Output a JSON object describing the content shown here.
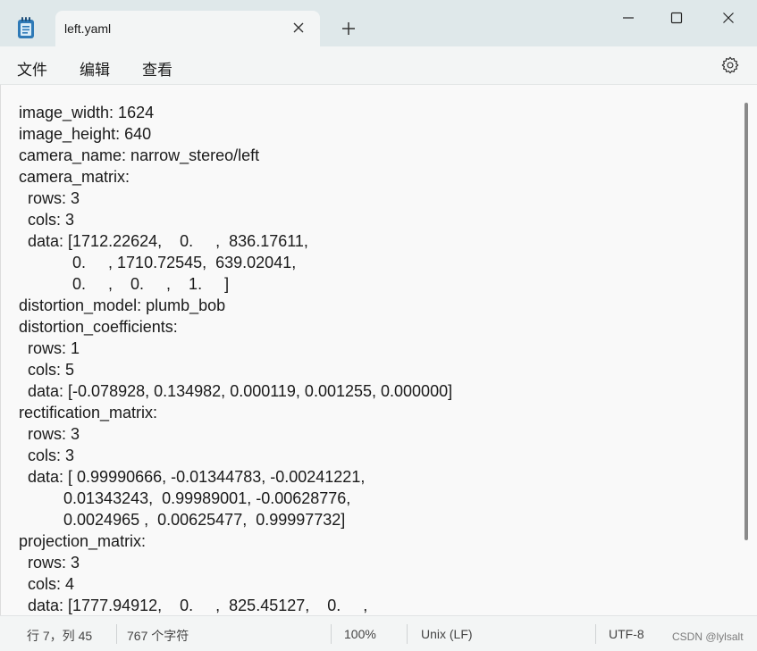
{
  "tab": {
    "title": "left.yaml"
  },
  "menu": {
    "file": "文件",
    "edit": "编辑",
    "view": "查看"
  },
  "editor": {
    "content": "image_width: 1624\nimage_height: 640\ncamera_name: narrow_stereo/left\ncamera_matrix:\n  rows: 3\n  cols: 3\n  data: [1712.22624,    0.     ,  836.17611,\n            0.     , 1710.72545,  639.02041,\n            0.     ,    0.     ,    1.     ]\ndistortion_model: plumb_bob\ndistortion_coefficients:\n  rows: 1\n  cols: 5\n  data: [-0.078928, 0.134982, 0.000119, 0.001255, 0.000000]\nrectification_matrix:\n  rows: 3\n  cols: 3\n  data: [ 0.99990666, -0.01344783, -0.00241221,\n          0.01343243,  0.99989001, -0.00628776,\n          0.0024965 ,  0.00625477,  0.99997732]\nprojection_matrix:\n  rows: 3\n  cols: 4\n  data: [1777.94912,    0.     ,  825.45127,    0.     ,"
  },
  "status": {
    "position": "行 7，列 45",
    "char_count": "767 个字符",
    "zoom": "100%",
    "line_ending": "Unix (LF)",
    "encoding": "UTF-8"
  },
  "watermark": "CSDN @lylsalt",
  "icons": {
    "app": "notepad-icon",
    "close_tab": "close-icon",
    "new_tab": "plus-icon",
    "settings": "gear-icon"
  }
}
